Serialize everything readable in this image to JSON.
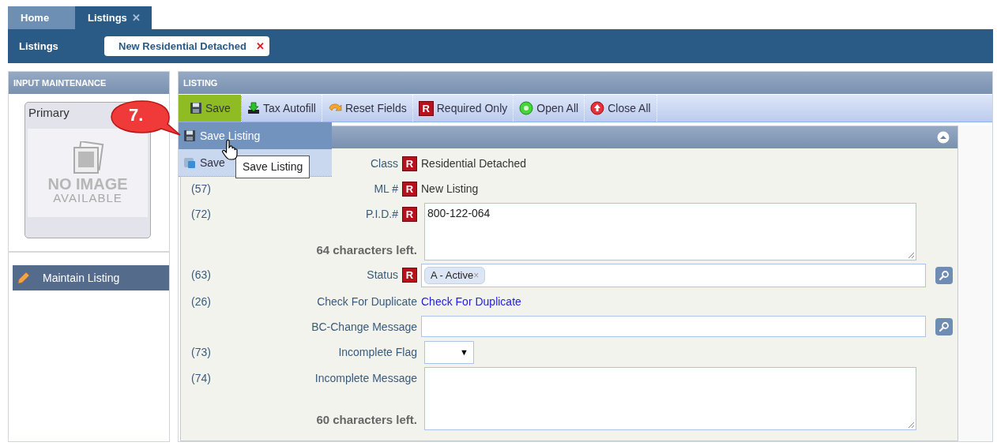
{
  "tabs": [
    {
      "label": "Home",
      "selected": false
    },
    {
      "label": "Listings",
      "selected": true,
      "close": "✕"
    }
  ],
  "subbar": {
    "title": "Listings",
    "tabs": [
      {
        "label": "New Residential Detached",
        "selected": true,
        "close": "✕"
      }
    ]
  },
  "sidebar": {
    "title": "INPUT MAINTENANCE",
    "photo": {
      "label": "Primary",
      "line1": "NO IMAGE",
      "line2": "AVAILABLE"
    },
    "items": [
      {
        "label": "Maintain Listing",
        "selected": true
      }
    ]
  },
  "panel": {
    "title": "LISTING",
    "toolbar": [
      {
        "kind": "save",
        "label": "Save",
        "selected": true
      },
      {
        "kind": "tax",
        "label": "Tax Autofill",
        "selected": false
      },
      {
        "kind": "reset",
        "label": "Reset Fields",
        "selected": false
      },
      {
        "kind": "required",
        "label": "Required Only",
        "badge": "R",
        "selected": false
      },
      {
        "kind": "open",
        "label": "Open All",
        "selected": false
      },
      {
        "kind": "close",
        "label": "Close All",
        "selected": false
      }
    ],
    "save_menu": [
      {
        "kind": "save",
        "label": "Save Listing",
        "selected": true
      },
      {
        "kind": "template",
        "label": "Save",
        "selected": false
      }
    ],
    "tooltip": "Save Listing",
    "callout": "7.",
    "fields": [
      {
        "kind": "text",
        "label": "Class",
        "badge": "R",
        "value": "Residential Detached"
      },
      {
        "kind": "text",
        "number": "(57)",
        "label": "ML #",
        "badge": "R",
        "value": "New Listing"
      },
      {
        "kind": "textarea",
        "number": "(72)",
        "label": "P.I.D.#",
        "badge": "R",
        "value": "800-122-064",
        "hint": "64 characters left."
      },
      {
        "kind": "tags",
        "number": "(63)",
        "label": "Status",
        "badge": "R",
        "tags": [
          {
            "label": "A - Active",
            "remove": "×"
          }
        ],
        "search": true
      },
      {
        "kind": "link",
        "number": "(26)",
        "label": "Check For Duplicate",
        "value": "Check For Duplicate"
      },
      {
        "kind": "input",
        "label": "BC-Change Message",
        "search": true
      },
      {
        "kind": "select",
        "number": "(73)",
        "label": "Incomplete Flag",
        "arrow": "▼"
      },
      {
        "kind": "textarea",
        "number": "(74)",
        "label": "Incomplete Message",
        "hint": "60 characters left."
      }
    ]
  }
}
